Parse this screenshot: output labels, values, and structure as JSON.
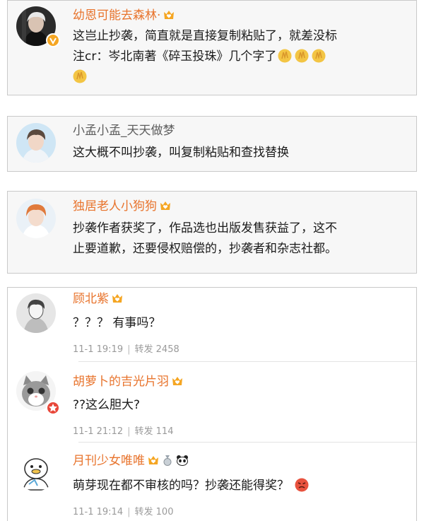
{
  "comments": [
    {
      "name": "幼恩可能去森林·",
      "line1": "这岂止抄袭，简直就是直接复制粘贴了，就差没标",
      "line2": "注cr：岑北南著《碎玉投珠》几个字了"
    },
    {
      "name": "小孟小孟_天天做梦",
      "line1": "这大概不叫抄袭，叫复制粘贴和查找替换"
    },
    {
      "name": "独居老人小狗狗",
      "line1": "抄袭作者获奖了，作品选也出版发售获益了，这不",
      "line2": "止要道歉，还要侵权赔偿的，抄袭者和杂志社都。"
    }
  ],
  "thread": [
    {
      "name": "顾北紫",
      "text": "？？？ 有事吗？",
      "time": "11-1 19:19",
      "repost_label": "转发",
      "repost_count": "2458"
    },
    {
      "name": "胡萝卜的吉光片羽",
      "text": "??这么胆大?",
      "time": "11-1 21:12",
      "repost_label": "转发",
      "repost_count": "114"
    },
    {
      "name": "月刊少女唯唯",
      "text": "萌芽现在都不审核的吗？抄袭还能得奖？",
      "time": "11-1 19:14",
      "repost_label": "转发",
      "repost_count": "100"
    }
  ],
  "colors": {
    "username_orange": "#e8742d",
    "username_gray": "#5e5e5e",
    "body_text": "#1a1a1a",
    "meta_text": "#9a9a9a",
    "vip_badge": "#f5a623",
    "card_bg": "#f7f7f7"
  },
  "icons": {
    "vip_badge": "crown-heart-badge-icon",
    "verified": "verified-v-icon",
    "emoji_clap": "clap-emoji-icon",
    "emoji_angry": "angry-face-emoji-icon",
    "medal": "medal-icon",
    "panda": "panda-icon"
  }
}
